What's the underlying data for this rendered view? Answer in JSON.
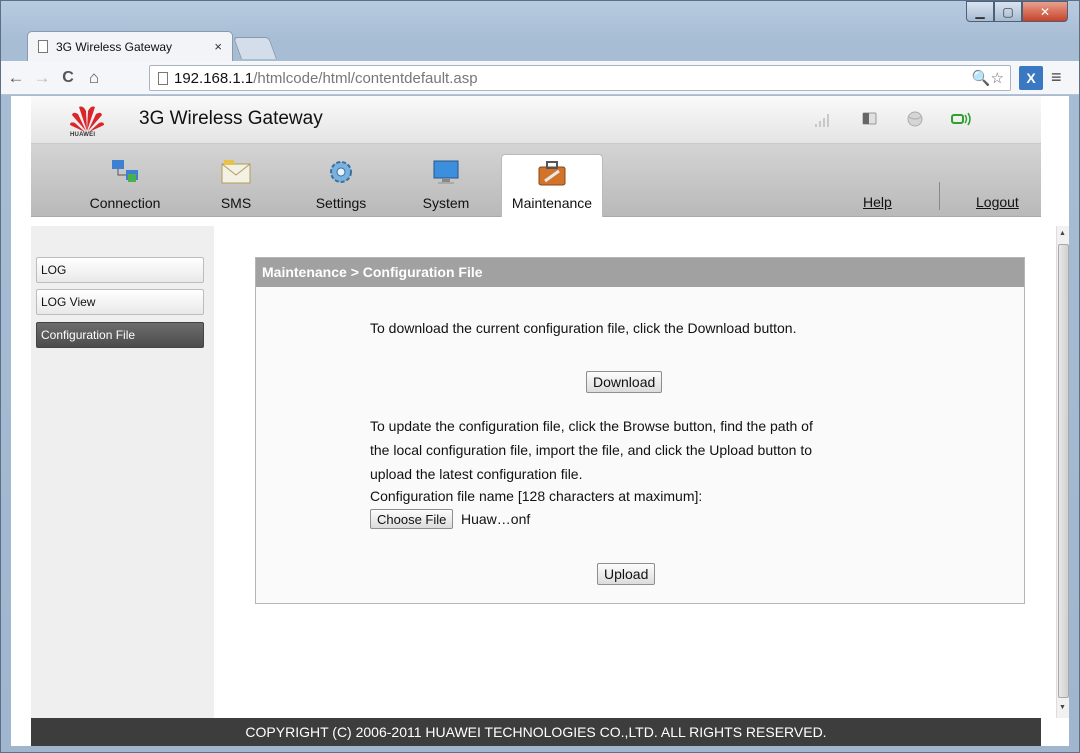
{
  "browser": {
    "tab_title": "3G Wireless Gateway",
    "tab_close": "×",
    "url_host": "192.168.1.1",
    "url_path": "/htmlcode/html/contentdefault.asp",
    "omni_icons": "🔍☆",
    "back": "←",
    "forward": "→",
    "reload": "C",
    "home": "⌂",
    "menu": "≡"
  },
  "header": {
    "logo_text": "HUAWEI",
    "title": "3G Wireless Gateway"
  },
  "nav": {
    "items": [
      {
        "label": "Connection"
      },
      {
        "label": "SMS"
      },
      {
        "label": "Settings"
      },
      {
        "label": "System"
      },
      {
        "label": "Maintenance"
      }
    ],
    "help": "Help",
    "logout": "Logout",
    "active": "Maintenance"
  },
  "sidebar": {
    "items": [
      {
        "label": "LOG"
      },
      {
        "label": "LOG View"
      },
      {
        "label": "Configuration File"
      }
    ],
    "active": "Configuration File"
  },
  "panel": {
    "title": "Maintenance > Configuration File",
    "download_text": "To download the current configuration file, click the Download button.",
    "download_button": "Download",
    "update_line1": "To update the configuration file, click the Browse button, find the path of",
    "update_line2": "the local configuration file, import the file, and click the Upload button to",
    "update_line3": "upload the latest configuration file.",
    "file_label": "Configuration file name [128 characters at maximum]:",
    "choose_file_button": "Choose File",
    "chosen_file": "Huaw…onf",
    "upload_button": "Upload"
  },
  "footer": {
    "copyright": "COPYRIGHT (C) 2006-2011 HUAWEI TECHNOLOGIES CO.,LTD. ALL RIGHTS RESERVED."
  },
  "colors": {
    "accent_red": "#d8262b",
    "nav_bg": "#c6c6c6",
    "panel_title_bg": "#a1a1a1",
    "footer_bg": "#3d3d3d",
    "sidebar_active": "#555555"
  }
}
